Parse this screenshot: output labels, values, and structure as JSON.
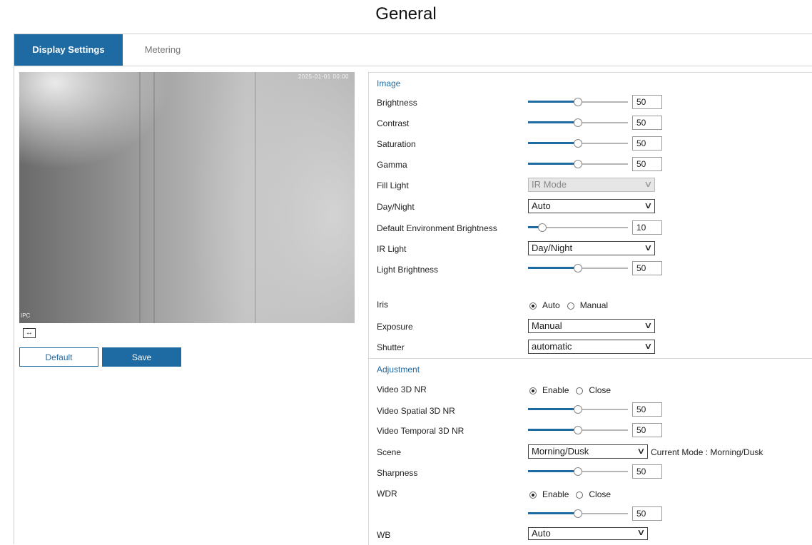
{
  "title": "General",
  "tabs": [
    {
      "label": "Display Settings",
      "active": true
    },
    {
      "label": "Metering",
      "active": false
    }
  ],
  "preview": {
    "timestamp": "2025-01-01 00:00",
    "channel": "IPC",
    "fit_icon": "↔"
  },
  "buttons": {
    "default": "Default",
    "save": "Save"
  },
  "colors": {
    "accent": "#1e6aa3"
  },
  "image": {
    "heading": "Image",
    "brightness": {
      "label": "Brightness",
      "value": "50"
    },
    "contrast": {
      "label": "Contrast",
      "value": "50"
    },
    "saturation": {
      "label": "Saturation",
      "value": "50"
    },
    "gamma": {
      "label": "Gamma",
      "value": "50"
    },
    "fill_light": {
      "label": "Fill Light",
      "value": "IR Mode"
    },
    "day_night": {
      "label": "Day/Night",
      "value": "Auto"
    },
    "env_brightness": {
      "label": "Default Environment Brightness",
      "value": "10"
    },
    "ir_light": {
      "label": "IR Light",
      "value": "Day/Night"
    },
    "light_brightness": {
      "label": "Light Brightness",
      "value": "50"
    },
    "iris": {
      "label": "Iris",
      "opt1": "Auto",
      "opt2": "Manual",
      "selected": "Auto"
    },
    "exposure": {
      "label": "Exposure",
      "value": "Manual"
    },
    "shutter": {
      "label": "Shutter",
      "value": "automatic"
    }
  },
  "adjustment": {
    "heading": "Adjustment",
    "video_3d_nr": {
      "label": "Video 3D NR",
      "opt1": "Enable",
      "opt2": "Close",
      "selected": "Enable"
    },
    "spatial_nr": {
      "label": "Video Spatial 3D NR",
      "value": "50"
    },
    "temporal_nr": {
      "label": "Video Temporal 3D NR",
      "value": "50"
    },
    "scene": {
      "label": "Scene",
      "value": "Morning/Dusk",
      "note": "Current Mode : Morning/Dusk"
    },
    "sharpness": {
      "label": "Sharpness",
      "value": "50"
    },
    "wdr": {
      "label": "WDR",
      "opt1": "Enable",
      "opt2": "Close",
      "selected": "Enable",
      "value": "50"
    },
    "wb": {
      "label": "WB",
      "value": "Auto"
    }
  }
}
